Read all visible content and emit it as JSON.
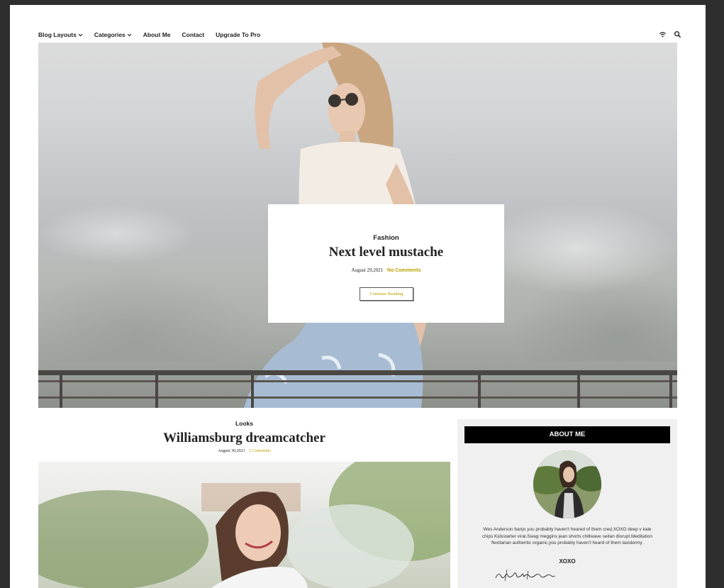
{
  "nav": {
    "items": [
      {
        "label": "Blog Layouts",
        "has_dropdown": true
      },
      {
        "label": "Categories",
        "has_dropdown": true
      },
      {
        "label": "About Me",
        "has_dropdown": false
      },
      {
        "label": "Contact",
        "has_dropdown": false
      },
      {
        "label": "Upgrade To Pro",
        "has_dropdown": false
      }
    ],
    "icons": [
      "rss-icon",
      "search-icon"
    ]
  },
  "hero": {
    "category": "Fashion",
    "title": "Next level mustache",
    "date": "August 29,2021",
    "comments": "No Comments",
    "button_label": "Continue Reading"
  },
  "post": {
    "category": "Looks",
    "title": "Williamsburg dreamcatcher",
    "date": "August 30,2021",
    "comments": "2 Comments"
  },
  "sidebar": {
    "heading": "ABOUT ME",
    "bio_line1": "Wes Anderson banjo you probably haven't heared of them cred,XOXO deep v kale",
    "bio_line2": "chips Kickstarter viral.Swag meggins jean shorts chillwave seitan disrupt.Meditation",
    "bio_line3": "flexitarian authentic organic,you probably haven't heard of them taxidermy.",
    "sign_off": "XOXO",
    "signature": "elizabeth norton"
  },
  "colors": {
    "accent": "#b9a100",
    "sidebar_bg": "#f0f0f0",
    "heading_bg": "#000000"
  }
}
